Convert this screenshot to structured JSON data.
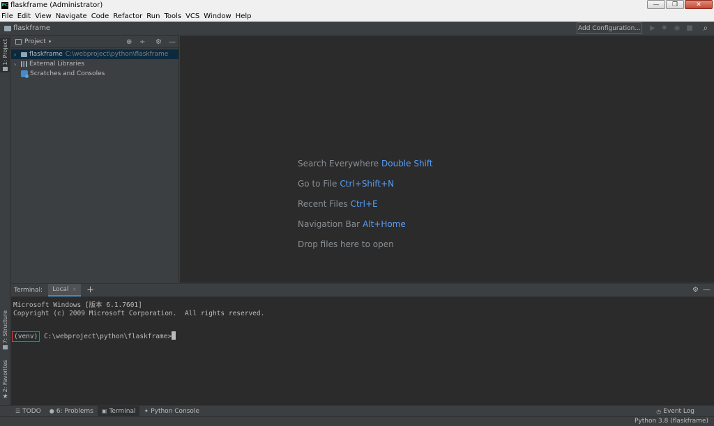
{
  "window": {
    "app_icon": "PC",
    "title": "flaskframe (Administrator)",
    "controls": {
      "minimize": "—",
      "maximize": "❐",
      "close": "✕"
    }
  },
  "menu": [
    "File",
    "Edit",
    "View",
    "Navigate",
    "Code",
    "Refactor",
    "Run",
    "Tools",
    "VCS",
    "Window",
    "Help"
  ],
  "navbar": {
    "breadcrumb": "flaskframe",
    "add_configuration": "Add Configuration...",
    "tools": {
      "run": "▶",
      "debug": "✹",
      "coverage": "◉",
      "stop": "■",
      "search": "⌕"
    }
  },
  "left_stripe": {
    "project_tab": "1: Project",
    "structure_tab": "7: Structure",
    "favorites_tab": "2: Favorites"
  },
  "project_panel": {
    "title": "Project",
    "caret": "▾",
    "tools": {
      "locate": "⊕",
      "collapse": "÷",
      "settings": "⚙",
      "hide": "—"
    },
    "tree": [
      {
        "arrow": "›",
        "label": "flaskframe",
        "path": "C:\\webproject\\python\\flaskframe",
        "selected": true
      },
      {
        "arrow": "›",
        "label": "External Libraries",
        "path": ""
      },
      {
        "arrow": "",
        "label": "Scratches and Consoles",
        "path": ""
      }
    ]
  },
  "editor_hints": [
    {
      "text": "Search Everywhere",
      "key": "Double Shift"
    },
    {
      "text": "Go to File",
      "key": "Ctrl+Shift+N"
    },
    {
      "text": "Recent Files",
      "key": "Ctrl+E"
    },
    {
      "text": "Navigation Bar",
      "key": "Alt+Home"
    },
    {
      "text": "Drop files here to open",
      "key": ""
    }
  ],
  "terminal": {
    "label": "Terminal:",
    "tab": "Local",
    "tab_close": "×",
    "add": "+",
    "settings": "⚙",
    "hide": "—",
    "lines": [
      "Microsoft Windows [版本 6.1.7601]",
      "Copyright (c) 2009 Microsoft Corporation.  All rights reserved."
    ],
    "venv": "(venv)",
    "prompt": "C:\\webproject\\python\\flaskframe>",
    "highlight_color": "#e53935"
  },
  "bottom_bar": {
    "todo": "TODO",
    "problems": "6: Problems",
    "terminal": "Terminal",
    "python_console": "Python Console",
    "event_log": "Event Log"
  },
  "status_bar": {
    "interpreter": "Python 3.8 (flaskframe)"
  }
}
